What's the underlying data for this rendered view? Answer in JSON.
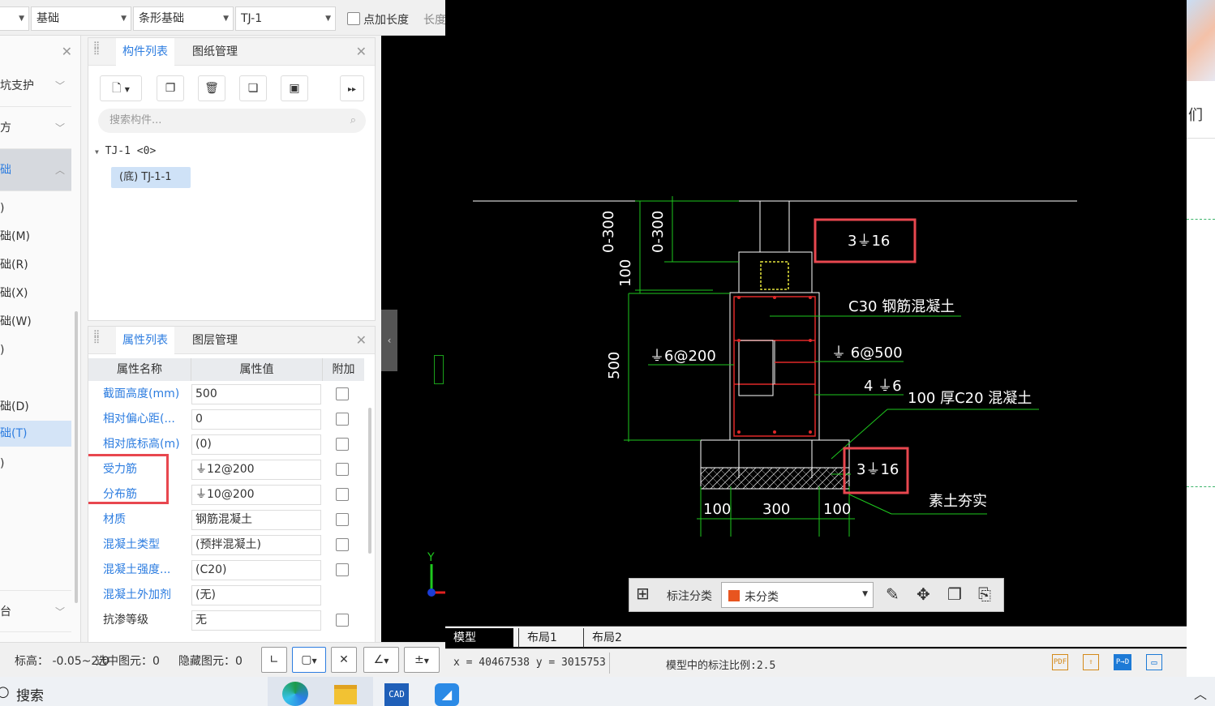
{
  "toolbar": {
    "dd0_value": "",
    "dd1_value": "基础",
    "dd2_value": "条形基础",
    "dd3_value": "TJ-1",
    "checkbox_label": "点加长度",
    "length_label": "长度"
  },
  "left_nav": {
    "sections": [
      {
        "label": "坑支护"
      },
      {
        "label": "方"
      },
      {
        "label": "础"
      },
      {
        "label": "台"
      }
    ],
    "items": [
      {
        "label": ")"
      },
      {
        "label": "础(M)"
      },
      {
        "label": "础(R)"
      },
      {
        "label": "础(X)"
      },
      {
        "label": "础(W)"
      },
      {
        "label": ")"
      },
      {
        "label": "础(D)"
      },
      {
        "label": "础(T)"
      },
      {
        "label": ")"
      }
    ]
  },
  "component_panel": {
    "tabs": [
      {
        "label": "构件列表"
      },
      {
        "label": "图纸管理"
      }
    ],
    "search_placeholder": "搜索构件...",
    "tree_parent": "TJ-1 <0>",
    "tree_child": "(底) TJ-1-1"
  },
  "property_panel": {
    "tabs": [
      {
        "label": "属性列表"
      },
      {
        "label": "图层管理"
      }
    ],
    "headers": {
      "name": "属性名称",
      "value": "属性值",
      "extra": "附加"
    },
    "rows": [
      {
        "name": "截面高度(mm)",
        "value": "500"
      },
      {
        "name": "相对偏心距(...",
        "value": "0"
      },
      {
        "name": "相对底标高(m)",
        "value": "(0)"
      },
      {
        "name": "受力筋",
        "value": "⏚12@200"
      },
      {
        "name": "分布筋",
        "value": "⏚10@200"
      },
      {
        "name": "材质",
        "value": "钢筋混凝土"
      },
      {
        "name": "混凝土类型",
        "value": "(预拌混凝土)"
      },
      {
        "name": "混凝土强度...",
        "value": "(C20)"
      },
      {
        "name": "混凝土外加剂",
        "value": "(无)"
      },
      {
        "name": "抗渗等级",
        "value": "无"
      }
    ]
  },
  "status": {
    "elevation": "标高：  -0.05~2.0",
    "selected": "选中图元：0",
    "hidden": "隐藏图元：0"
  },
  "cad": {
    "tabs": [
      {
        "label": "模型"
      },
      {
        "label": "布局1"
      },
      {
        "label": "布局2"
      }
    ],
    "coords": "x = 40467538  y = 3015753",
    "scale": "模型中的标注比例:2.5",
    "float_label": "标注分类",
    "float_value": "未分类",
    "texts": {
      "t_3c16_top": "3⏚16",
      "t_c30": "C30  钢筋混凝土",
      "t_c6_200": "⏚6@200",
      "t_c6_500": "⏚ 6@500",
      "t_4c6": "4 ⏚6",
      "t_100c20": "100  厚C20  混凝土",
      "t_3c16_bot": "3⏚16",
      "t_soil": "素土夯实",
      "t_d100a": "100",
      "t_d300": "300",
      "t_d100b": "100",
      "t_v0300a": "0-300",
      "t_v0300b": "0-300",
      "t_v100": "100",
      "t_v500": "500",
      "axis_y": "Y"
    }
  },
  "taskbar": {
    "search": "搜索"
  },
  "right_strip": {
    "text": "们"
  }
}
